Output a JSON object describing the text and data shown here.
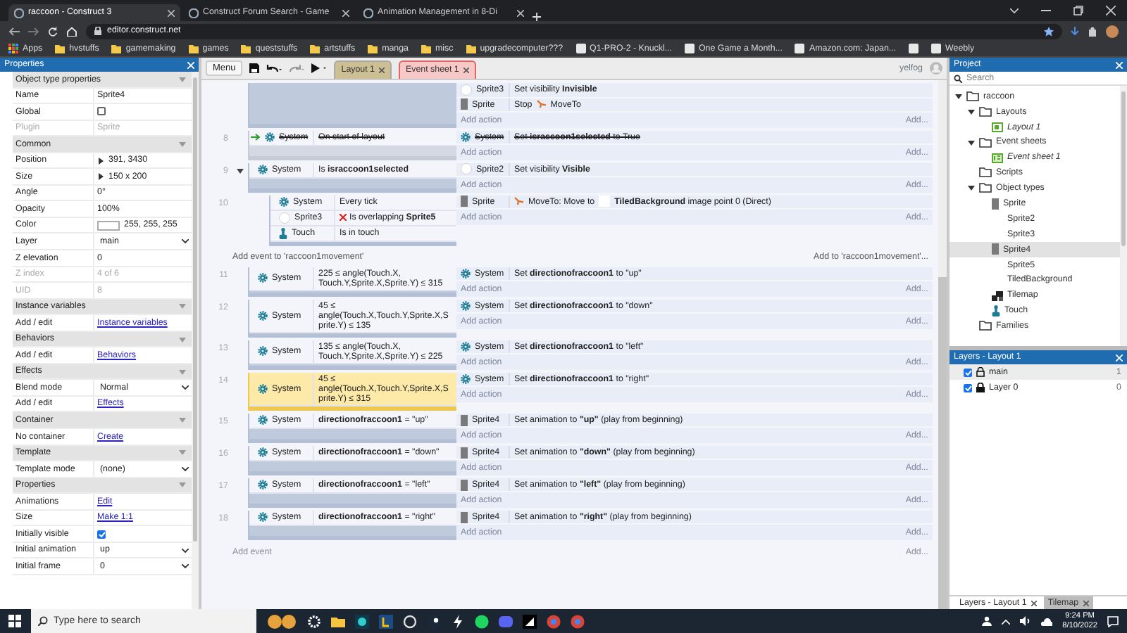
{
  "browser": {
    "tabs": [
      {
        "title": "raccoon - Construct 3",
        "selected": true
      },
      {
        "title": "Construct Forum Search - Game",
        "selected": false
      },
      {
        "title": "Animation Management in 8-Di",
        "selected": false
      }
    ],
    "address": "editor.construct.net",
    "bookmarks": [
      {
        "label": "Apps",
        "kind": "apps"
      },
      {
        "label": "hvstuffs",
        "kind": "folder"
      },
      {
        "label": "gamemaking",
        "kind": "folder"
      },
      {
        "label": "games",
        "kind": "folder"
      },
      {
        "label": "queststuffs",
        "kind": "folder"
      },
      {
        "label": "artstuffs",
        "kind": "folder"
      },
      {
        "label": "manga",
        "kind": "folder"
      },
      {
        "label": "misc",
        "kind": "folder"
      },
      {
        "label": "upgradecomputer???",
        "kind": "folder"
      },
      {
        "label": "Q1-PRO-2 - Knuckl...",
        "kind": "site"
      },
      {
        "label": "One Game a Month...",
        "kind": "site"
      },
      {
        "label": "Amazon.com: Japan...",
        "kind": "site"
      },
      {
        "kind": "site"
      },
      {
        "label": "Weebly",
        "kind": "site"
      }
    ]
  },
  "toolbar": {
    "menu": "Menu",
    "tabs": [
      {
        "label": "Layout 1",
        "kind": "layout",
        "selected": false
      },
      {
        "label": "Event sheet 1",
        "kind": "eventsheet",
        "selected": true
      }
    ],
    "user": "yelfog"
  },
  "properties": {
    "title": "Properties",
    "rows": [
      {
        "kind": "section",
        "label": "Object type properties"
      },
      {
        "kind": "text",
        "label": "Name",
        "value": "Sprite4",
        "disabled": false
      },
      {
        "kind": "check",
        "label": "Global",
        "checked": false,
        "disabled": false
      },
      {
        "kind": "text",
        "label": "Plugin",
        "value": "Sprite",
        "disabled": true
      },
      {
        "kind": "section",
        "label": "Common"
      },
      {
        "kind": "expand",
        "label": "Position",
        "value": "391, 3430",
        "disabled": false
      },
      {
        "kind": "expand",
        "label": "Size",
        "value": "150 x 200",
        "disabled": false
      },
      {
        "kind": "text",
        "label": "Angle",
        "value": "0°",
        "disabled": false
      },
      {
        "kind": "text",
        "label": "Opacity",
        "value": "100%",
        "disabled": false
      },
      {
        "kind": "color",
        "label": "Color",
        "value": "255, 255, 255",
        "color": "#ffffff",
        "disabled": false
      },
      {
        "kind": "select",
        "label": "Layer",
        "value": "main",
        "disabled": false
      },
      {
        "kind": "text",
        "label": "Z elevation",
        "value": "0",
        "disabled": false
      },
      {
        "kind": "text",
        "label": "Z index",
        "value": "4 of 6",
        "disabled": true
      },
      {
        "kind": "text",
        "label": "UID",
        "value": "8",
        "disabled": true
      },
      {
        "kind": "section",
        "label": "Instance variables"
      },
      {
        "kind": "link",
        "label": "Add / edit",
        "value": "Instance variables",
        "disabled": false
      },
      {
        "kind": "section",
        "label": "Behaviors"
      },
      {
        "kind": "link",
        "label": "Add / edit",
        "value": "Behaviors",
        "disabled": false
      },
      {
        "kind": "section",
        "label": "Effects"
      },
      {
        "kind": "select",
        "label": "Blend mode",
        "value": "Normal",
        "disabled": false
      },
      {
        "kind": "link",
        "label": "Add / edit",
        "value": "Effects",
        "disabled": false
      },
      {
        "kind": "section",
        "label": "Container"
      },
      {
        "kind": "link",
        "label": "No container",
        "value": "Create",
        "disabled": false
      },
      {
        "kind": "section",
        "label": "Template"
      },
      {
        "kind": "select",
        "label": "Template mode",
        "value": "(none)",
        "disabled": false
      },
      {
        "kind": "section",
        "label": "Properties"
      },
      {
        "kind": "link",
        "label": "Animations",
        "value": "Edit",
        "disabled": false
      },
      {
        "kind": "link",
        "label": "Size",
        "value": "Make 1:1",
        "disabled": false
      },
      {
        "kind": "check",
        "label": "Initially visible",
        "checked": true,
        "disabled": false
      },
      {
        "kind": "select",
        "label": "Initial animation",
        "value": "up",
        "disabled": false
      },
      {
        "kind": "select",
        "label": "Initial frame",
        "value": "0",
        "disabled": false
      }
    ]
  },
  "event_sheet": {
    "events": [
      {
        "kind": "event",
        "sub": false,
        "disabled": false,
        "selected": false,
        "actions": [
          {
            "object": "Sprite3",
            "kind": "circle",
            "parts": [
              {
                "kind": "text",
                "text": "Set visibility **Invisible**"
              }
            ]
          },
          {
            "object": "Sprite",
            "kind": "block",
            "parts": [
              {
                "kind": "text",
                "text": "Stop"
              },
              {
                "kind": "behavior"
              },
              {
                "kind": "text",
                "text": "MoveTo"
              }
            ]
          }
        ],
        "add_action": "Add action",
        "add_more": "Add..."
      },
      {
        "kind": "event",
        "number": "8",
        "sub": false,
        "disabled": true,
        "selected": false,
        "conditions": [
          {
            "object": "System",
            "kind": "gear",
            "trigger": true,
            "inverted": false,
            "text": "On start of layout"
          }
        ],
        "actions": [
          {
            "object": "System",
            "kind": "gear",
            "parts": [
              {
                "kind": "text",
                "text": "Set **israccoon1selected** to True"
              }
            ]
          }
        ],
        "add_action": "Add action",
        "add_more": "Add..."
      },
      {
        "kind": "event",
        "number": "9",
        "sub": false,
        "expanded": true,
        "disabled": false,
        "selected": false,
        "conditions": [
          {
            "object": "System",
            "kind": "gear",
            "trigger": false,
            "inverted": false,
            "text": "Is **israccoon1selected**"
          }
        ],
        "actions": [
          {
            "object": "Sprite2",
            "kind": "circle",
            "parts": [
              {
                "kind": "text",
                "text": "Set visibility **Visible**"
              }
            ]
          }
        ],
        "add_action": "Add action",
        "add_more": "Add..."
      },
      {
        "kind": "event",
        "number": "10",
        "sub": true,
        "disabled": false,
        "selected": false,
        "conditions": [
          {
            "object": "System",
            "kind": "gear",
            "trigger": false,
            "inverted": false,
            "text": "Every tick"
          },
          {
            "object": "Sprite3",
            "kind": "circle",
            "trigger": false,
            "inverted": true,
            "text": "Is overlapping **Sprite5**"
          },
          {
            "object": "Touch",
            "kind": "hand",
            "trigger": false,
            "inverted": false,
            "text": "Is in touch"
          }
        ],
        "actions": [
          {
            "object": "Sprite",
            "kind": "block",
            "parts": [
              {
                "kind": "behavior"
              },
              {
                "kind": "text",
                "text": "MoveTo: Move to"
              },
              {
                "kind": "swatch"
              },
              {
                "kind": "text",
                "text": "**TiledBackground** image point 0 (Direct)"
              }
            ]
          }
        ],
        "add_action": "Add action",
        "add_more": "Add..."
      },
      {
        "kind": "add_event",
        "label": "Add event to 'raccoon1movement'",
        "add_more": "Add to 'raccoon1movement'..."
      },
      {
        "kind": "event",
        "number": "11",
        "sub": false,
        "disabled": false,
        "selected": false,
        "conditions": [
          {
            "object": "System",
            "kind": "gear",
            "trigger": false,
            "inverted": false,
            "text": "225 ≤ angle(Touch.X, Touch.Y,Sprite.X,Sprite.Y) ≤ 315"
          }
        ],
        "actions": [
          {
            "object": "System",
            "kind": "gear",
            "parts": [
              {
                "kind": "text",
                "text": "Set **directionofraccoon1** to \"up\""
              }
            ]
          }
        ],
        "add_action": "Add action",
        "add_more": "Add..."
      },
      {
        "kind": "event",
        "number": "12",
        "sub": false,
        "disabled": false,
        "selected": false,
        "conditions": [
          {
            "object": "System",
            "kind": "gear",
            "trigger": false,
            "inverted": false,
            "text": "45 ≤ angle(Touch.X,Touch.Y,Sprite.X,Sprite.Y) ≤ 135"
          }
        ],
        "actions": [
          {
            "object": "System",
            "kind": "gear",
            "parts": [
              {
                "kind": "text",
                "text": "Set **directionofraccoon1** to \"down\""
              }
            ]
          }
        ],
        "add_action": "Add action",
        "add_more": "Add..."
      },
      {
        "kind": "event",
        "number": "13",
        "sub": false,
        "disabled": false,
        "selected": false,
        "conditions": [
          {
            "object": "System",
            "kind": "gear",
            "trigger": false,
            "inverted": false,
            "text": "135 ≤ angle(Touch.X, Touch.Y,Sprite.X,Sprite.Y) ≤ 225"
          }
        ],
        "actions": [
          {
            "object": "System",
            "kind": "gear",
            "parts": [
              {
                "kind": "text",
                "text": "Set **directionofraccoon1** to \"left\""
              }
            ]
          }
        ],
        "add_action": "Add action",
        "add_more": "Add..."
      },
      {
        "kind": "event",
        "number": "14",
        "sub": false,
        "disabled": false,
        "selected": true,
        "conditions": [
          {
            "object": "System",
            "kind": "gear",
            "trigger": false,
            "inverted": false,
            "text": "45 ≤ angle(Touch.X,Touch.Y,Sprite.X,Sprite.Y) ≤ 315"
          }
        ],
        "actions": [
          {
            "object": "System",
            "kind": "gear",
            "parts": [
              {
                "kind": "text",
                "text": "Set **directionofraccoon1** to \"right\""
              }
            ]
          }
        ],
        "add_action": "Add action",
        "add_more": "Add..."
      },
      {
        "kind": "event",
        "number": "15",
        "sub": false,
        "disabled": false,
        "selected": false,
        "conditions": [
          {
            "object": "System",
            "kind": "gear",
            "trigger": false,
            "inverted": false,
            "text": "**directionofraccoon1** = \"up\""
          }
        ],
        "actions": [
          {
            "object": "Sprite4",
            "kind": "block",
            "parts": [
              {
                "kind": "text",
                "text": "Set animation to **\"up\"** (play from beginning)"
              }
            ]
          }
        ],
        "add_action": "Add action",
        "add_more": "Add..."
      },
      {
        "kind": "event",
        "number": "16",
        "sub": false,
        "disabled": false,
        "selected": false,
        "conditions": [
          {
            "object": "System",
            "kind": "gear",
            "trigger": false,
            "inverted": false,
            "text": "**directionofraccoon1** = \"down\""
          }
        ],
        "actions": [
          {
            "object": "Sprite4",
            "kind": "block",
            "parts": [
              {
                "kind": "text",
                "text": "Set animation to **\"down\"** (play from beginning)"
              }
            ]
          }
        ],
        "add_action": "Add action",
        "add_more": "Add..."
      },
      {
        "kind": "event",
        "number": "17",
        "sub": false,
        "disabled": false,
        "selected": false,
        "conditions": [
          {
            "object": "System",
            "kind": "gear",
            "trigger": false,
            "inverted": false,
            "text": "**directionofraccoon1** = \"left\""
          }
        ],
        "actions": [
          {
            "object": "Sprite4",
            "kind": "block",
            "parts": [
              {
                "kind": "text",
                "text": "Set animation to **\"left\"** (play from beginning)"
              }
            ]
          }
        ],
        "add_action": "Add action",
        "add_more": "Add..."
      },
      {
        "kind": "event",
        "number": "18",
        "sub": false,
        "disabled": false,
        "selected": false,
        "conditions": [
          {
            "object": "System",
            "kind": "gear",
            "trigger": false,
            "inverted": false,
            "text": "**directionofraccoon1** = \"right\""
          }
        ],
        "actions": [
          {
            "object": "Sprite4",
            "kind": "block",
            "parts": [
              {
                "kind": "text",
                "text": "Set animation to **\"right\"** (play from beginning)"
              }
            ]
          }
        ],
        "add_action": "Add action",
        "add_more": "Add..."
      },
      {
        "kind": "add_event",
        "label": "Add event",
        "add_more": "Add..."
      }
    ]
  },
  "project": {
    "title": "Project",
    "search_placeholder": "Search",
    "tree": [
      {
        "label": "raccoon",
        "kind": "folder",
        "expanded": true,
        "selected": false,
        "children": [
          {
            "label": "Layouts",
            "kind": "folder",
            "expanded": true,
            "selected": false,
            "children": [
              {
                "label": "Layout 1",
                "kind": "layout",
                "selected": false
              }
            ]
          },
          {
            "label": "Event sheets",
            "kind": "folder",
            "expanded": true,
            "selected": false,
            "children": [
              {
                "label": "Event sheet 1",
                "kind": "eventsheet",
                "selected": false
              }
            ]
          },
          {
            "label": "Scripts",
            "kind": "folder",
            "selected": false
          },
          {
            "label": "Object types",
            "kind": "folder",
            "expanded": true,
            "selected": false,
            "children": [
              {
                "label": "Sprite",
                "kind": "block",
                "selected": false
              },
              {
                "label": "Sprite2",
                "kind": "none",
                "selected": false
              },
              {
                "label": "Sprite3",
                "kind": "none",
                "selected": false
              },
              {
                "label": "Sprite4",
                "kind": "block",
                "selected": true
              },
              {
                "label": "Sprite5",
                "kind": "none",
                "selected": false
              },
              {
                "label": "TiledBackground",
                "kind": "none",
                "selected": false
              },
              {
                "label": "Tilemap",
                "kind": "tiles",
                "selected": false
              },
              {
                "label": "Touch",
                "kind": "hand",
                "selected": false
              }
            ]
          },
          {
            "label": "Families",
            "kind": "folder",
            "selected": false
          }
        ]
      }
    ]
  },
  "layers": {
    "title": "Layers - Layout 1",
    "items": [
      {
        "name": "main",
        "visible": true,
        "locked": false,
        "count": "1",
        "selected": true
      },
      {
        "name": "Layer 0",
        "visible": true,
        "locked": true,
        "count": "0",
        "selected": false
      }
    ]
  },
  "bottom_tabs": [
    {
      "label": "Layers - Layout 1",
      "selected": true
    },
    {
      "label": "Tilemap",
      "selected": false
    }
  ],
  "taskbar": {
    "search_placeholder": "Type here to search",
    "time": "9:24 PM",
    "date": "8/10/2022"
  }
}
